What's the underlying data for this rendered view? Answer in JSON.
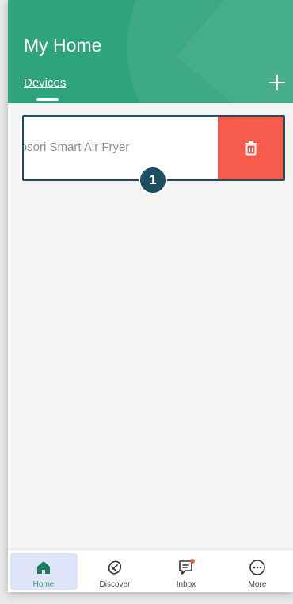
{
  "header": {
    "title": "My Home",
    "tab_label": "Devices",
    "add_icon": "plus-icon"
  },
  "devices": [
    {
      "name": "Cosori Smart Air Fryer",
      "delete_icon": "trash-icon"
    }
  ],
  "annotation": {
    "badge_number": "1"
  },
  "tabbar": [
    {
      "label": "Home",
      "icon": "home-icon",
      "active": true
    },
    {
      "label": "Discover",
      "icon": "discover-icon",
      "active": false
    },
    {
      "label": "Inbox",
      "icon": "inbox-icon",
      "active": false,
      "notification_dot": true
    },
    {
      "label": "More",
      "icon": "more-icon",
      "active": false
    }
  ],
  "colors": {
    "primary": "#2fa37a",
    "delete": "#f55a4a",
    "annotation": "#1f4f62",
    "active_tab_bg": "#dde4f6"
  }
}
